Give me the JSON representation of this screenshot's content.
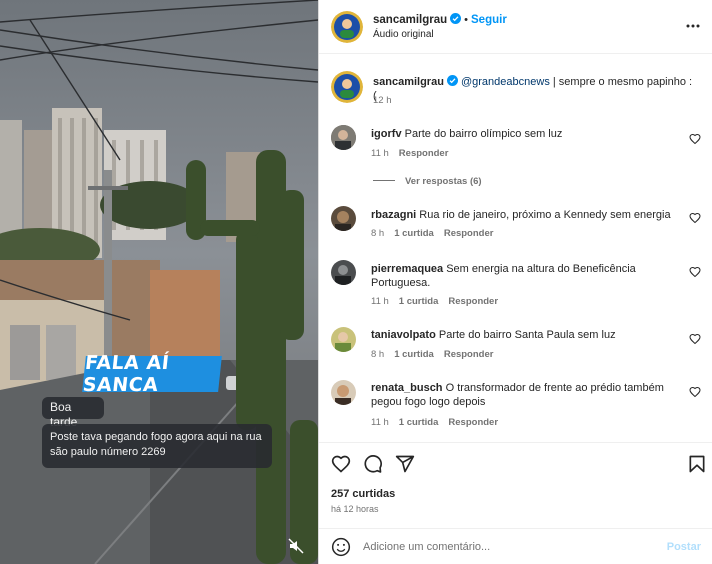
{
  "media": {
    "banner": "FALA AÍ SANCA",
    "msg1": "Boa tarde",
    "msg2": "Poste tava pegando fogo agora aqui na rua são paulo número 2269"
  },
  "header": {
    "username": "sancamilgrau",
    "follow": "Seguir",
    "subtitle": "Áudio original",
    "separator": "•"
  },
  "caption": {
    "username": "sancamilgrau",
    "mention": "@grandeabcnews",
    "text": "| sempre o mesmo papinho :(",
    "time": "12 h"
  },
  "comments": [
    {
      "username": "igorfv",
      "text": "Parte do bairro olímpico sem luz",
      "time": "11 h",
      "likes": "",
      "reply": "Responder",
      "view_replies": "Ver respostas (6)"
    },
    {
      "username": "rbazagni",
      "text": "Rua rio de janeiro, próximo a Kennedy sem energia",
      "time": "8 h",
      "likes": "1 curtida",
      "reply": "Responder"
    },
    {
      "username": "pierremaquea",
      "text": "Sem energia na altura do Beneficência Portuguesa.",
      "time": "11 h",
      "likes": "1 curtida",
      "reply": "Responder"
    },
    {
      "username": "taniavolpato",
      "text": "Parte do bairro Santa Paula sem luz",
      "time": "8 h",
      "likes": "1 curtida",
      "reply": "Responder"
    },
    {
      "username": "renata_busch",
      "text": "O transformador de frente ao prédio também pegou fogo logo depois",
      "time": "11 h",
      "likes": "1 curtida",
      "reply": "Responder"
    }
  ],
  "footer": {
    "likes": "257 curtidas",
    "time": "há 12 horas",
    "comment_placeholder": "Adicione um comentário...",
    "post": "Postar"
  },
  "colors": {
    "accent": "#0095f6",
    "banner": "#1e8fe0",
    "mention": "#00376b"
  }
}
